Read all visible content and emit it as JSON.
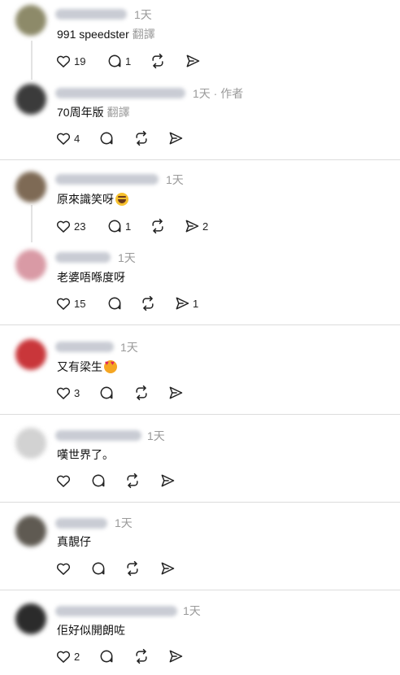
{
  "comments": [
    {
      "time": "1天",
      "text": "991 speedster",
      "translate": "翻譯",
      "counts": {
        "like": "19",
        "reply": "1",
        "repost": "",
        "share": ""
      },
      "colors": {
        "avatar": "#8d8a69"
      }
    },
    {
      "time": "1天 · 作者",
      "text": "70周年版",
      "translate": "翻譯",
      "counts": {
        "like": "4",
        "reply": "",
        "repost": "",
        "share": ""
      },
      "colors": {
        "avatar": "#3b3b3b"
      }
    },
    {
      "time": "1天",
      "text": "原來識笑呀",
      "emoji": "grinning-squinting-face",
      "counts": {
        "like": "23",
        "reply": "1",
        "repost": "",
        "share": "2"
      },
      "colors": {
        "avatar": "#7e6a55"
      }
    },
    {
      "time": "1天",
      "text": "老婆唔喺度呀",
      "counts": {
        "like": "15",
        "reply": "",
        "repost": "",
        "share": "1"
      },
      "colors": {
        "avatar": "#d99aa5"
      }
    },
    {
      "time": "1天",
      "text": "又有梁生",
      "emoji": "heart-eyes-face",
      "counts": {
        "like": "3",
        "reply": "",
        "repost": "",
        "share": ""
      },
      "colors": {
        "avatar": "#c9363a"
      }
    },
    {
      "time": "1天",
      "text": "嘆世界了。",
      "counts": {
        "like": "",
        "reply": "",
        "repost": "",
        "share": ""
      },
      "colors": {
        "avatar": "#d2d2d2"
      }
    },
    {
      "time": "1天",
      "text": "真靚仔",
      "counts": {
        "like": "",
        "reply": "",
        "repost": "",
        "share": ""
      },
      "colors": {
        "avatar": "#5f5a52"
      }
    },
    {
      "time": "1天",
      "text": "佢好似開朗咗",
      "counts": {
        "like": "2",
        "reply": "",
        "repost": "",
        "share": ""
      },
      "colors": {
        "avatar": "#2b2b2b"
      }
    }
  ],
  "icons": {
    "like": "heart-icon",
    "reply": "comment-bubble-icon",
    "repost": "repost-icon",
    "share": "send-icon"
  }
}
